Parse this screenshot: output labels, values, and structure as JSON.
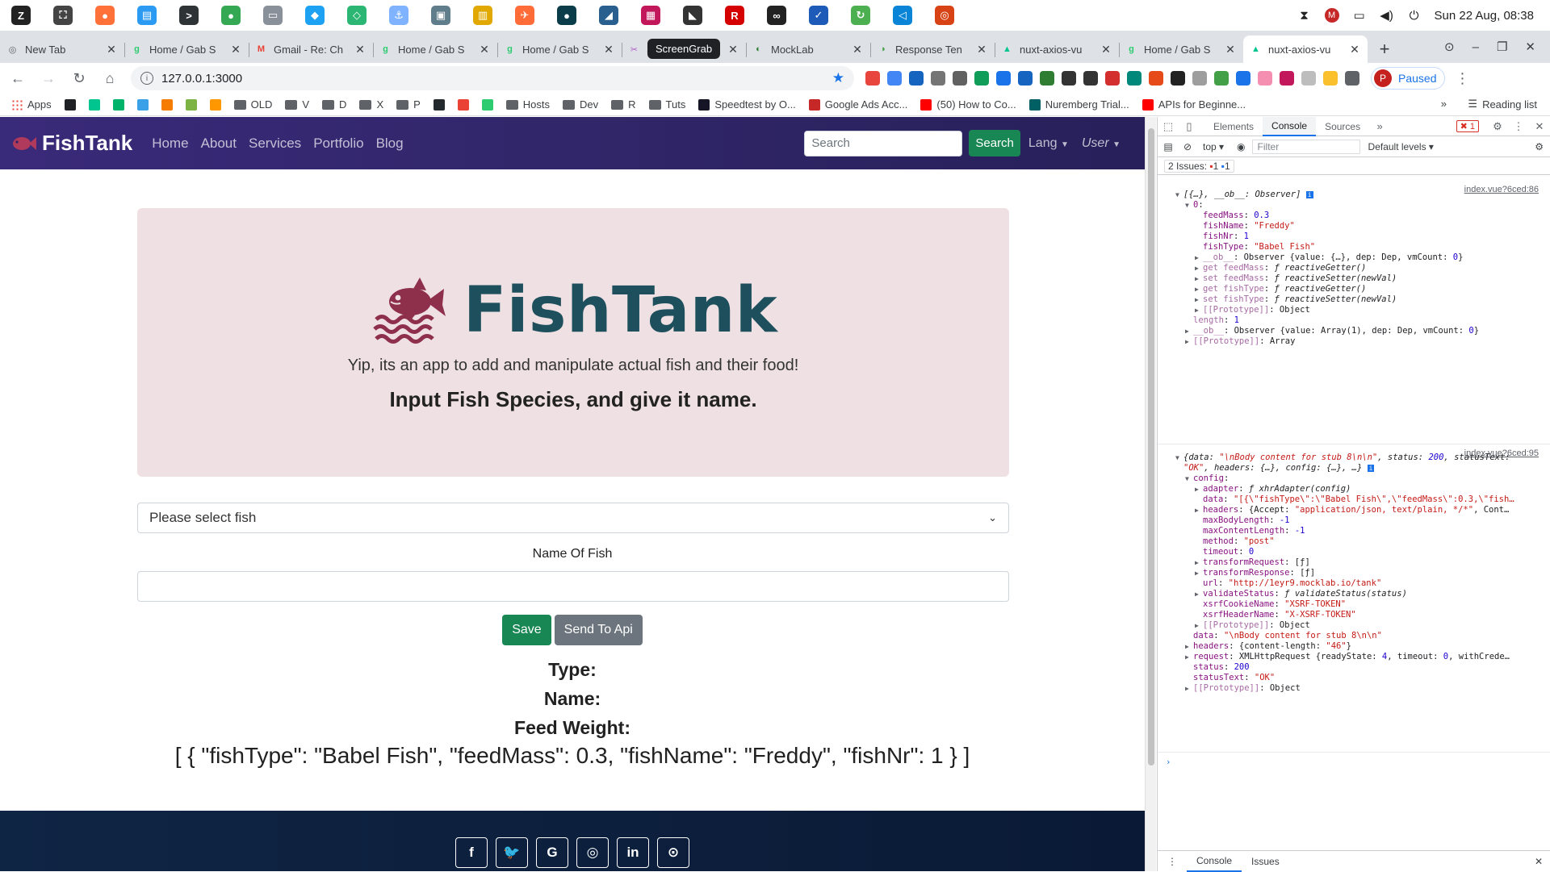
{
  "os": {
    "clock": "Sun 22 Aug, 08:38",
    "apps": [
      {
        "name": "zorin-menu-icon",
        "color": "#222222",
        "glyph": "Z"
      },
      {
        "name": "screenshot-icon",
        "color": "#444444",
        "glyph": "⛶"
      },
      {
        "name": "firefox-icon",
        "color": "#ff7139",
        "glyph": "●"
      },
      {
        "name": "store-icon",
        "color": "#2b9af3",
        "glyph": "▤"
      },
      {
        "name": "terminal-icon",
        "color": "#2e3436",
        "glyph": ">"
      },
      {
        "name": "chrome-icon",
        "color": "#34a853",
        "glyph": "●"
      },
      {
        "name": "files-icon",
        "color": "#8a9099",
        "glyph": "▭"
      },
      {
        "name": "bird-icon",
        "color": "#1da1f2",
        "glyph": "◆"
      },
      {
        "name": "vpn-icon",
        "color": "#2bb673",
        "glyph": "◇"
      },
      {
        "name": "docker-icon",
        "color": "#7fb3ff",
        "glyph": "⚓"
      },
      {
        "name": "app-icon",
        "color": "#607d8b",
        "glyph": "▣"
      },
      {
        "name": "database-icon",
        "color": "#e0a800",
        "glyph": "▥"
      },
      {
        "name": "postman-icon",
        "color": "#ff6c37",
        "glyph": "✈"
      },
      {
        "name": "gitkraken-icon",
        "color": "#0b3c49",
        "glyph": "●"
      },
      {
        "name": "mysql-icon",
        "color": "#285f8f",
        "glyph": "◢"
      },
      {
        "name": "db-tool-icon",
        "color": "#c2185b",
        "glyph": "▦"
      },
      {
        "name": "cat-icon",
        "color": "#333333",
        "glyph": "◣"
      },
      {
        "name": "rubymine-icon",
        "color": "#d50000",
        "glyph": "R"
      },
      {
        "name": "glasses-icon",
        "color": "#222222",
        "glyph": "∞"
      },
      {
        "name": "tasks-icon",
        "color": "#1e5bb8",
        "glyph": "✓"
      },
      {
        "name": "refresh-app-icon",
        "color": "#4caf50",
        "glyph": "↻"
      },
      {
        "name": "vscode-icon",
        "color": "#0a84d6",
        "glyph": "◁"
      },
      {
        "name": "ring-icon",
        "color": "#d84315",
        "glyph": "◎"
      }
    ]
  },
  "browser": {
    "tabs": [
      {
        "label": "New Tab",
        "fav": "#5f6368",
        "glyph": "◎"
      },
      {
        "label": "Home / Gab S",
        "fav": "#2ecc71",
        "glyph": "g"
      },
      {
        "label": "Gmail - Re: Ch",
        "fav": "#ea4335",
        "glyph": "M"
      },
      {
        "label": "Home / Gab S",
        "fav": "#2ecc71",
        "glyph": "g"
      },
      {
        "label": "Home / Gab S",
        "fav": "#2ecc71",
        "glyph": "g"
      },
      {
        "label": "ScreenGrab",
        "fav": "#b05cc7",
        "glyph": "✂"
      },
      {
        "label": "MockLab",
        "fav": "#2e7d32",
        "glyph": "◐"
      },
      {
        "label": "Response Ten",
        "fav": "#43a047",
        "glyph": "◑"
      },
      {
        "label": "nuxt-axios-vu",
        "fav": "#00c58e",
        "glyph": "▲"
      },
      {
        "label": "Home / Gab S",
        "fav": "#2ecc71",
        "glyph": "g"
      },
      {
        "label": "nuxt-axios-vu",
        "fav": "#00c58e",
        "glyph": "▲"
      }
    ],
    "tooltip": "ScreenGrab",
    "url": "127.0.0.1:3000",
    "paused_label": "Paused",
    "profile_initial": "P",
    "bookmarks": [
      {
        "label": "Apps",
        "kind": "apps",
        "color": "#e8453c"
      },
      {
        "label": "",
        "kind": "icon",
        "color": "#202124"
      },
      {
        "label": "",
        "kind": "icon",
        "color": "#00c58e"
      },
      {
        "label": "",
        "kind": "icon",
        "color": "#00b36b"
      },
      {
        "label": "",
        "kind": "icon",
        "color": "#3aa0e8"
      },
      {
        "label": "",
        "kind": "icon",
        "color": "#f57c00"
      },
      {
        "label": "",
        "kind": "icon",
        "color": "#7cb342"
      },
      {
        "label": "",
        "kind": "icon",
        "color": "#ff9800"
      },
      {
        "label": "OLD",
        "kind": "folder",
        "color": "#5f6368"
      },
      {
        "label": "V",
        "kind": "folder",
        "color": "#5f6368"
      },
      {
        "label": "D",
        "kind": "folder",
        "color": "#5f6368"
      },
      {
        "label": "X",
        "kind": "folder",
        "color": "#5f6368"
      },
      {
        "label": "P",
        "kind": "folder",
        "color": "#5f6368"
      },
      {
        "label": "",
        "kind": "icon",
        "color": "#24292e"
      },
      {
        "label": "",
        "kind": "icon",
        "color": "#ea4335"
      },
      {
        "label": "",
        "kind": "icon",
        "color": "#2ecc71"
      },
      {
        "label": "Hosts",
        "kind": "folder",
        "color": "#5f6368"
      },
      {
        "label": "Dev",
        "kind": "folder",
        "color": "#5f6368"
      },
      {
        "label": "R",
        "kind": "folder",
        "color": "#5f6368"
      },
      {
        "label": "Tuts",
        "kind": "folder",
        "color": "#5f6368"
      },
      {
        "label": "Speedtest by O...",
        "kind": "icon",
        "color": "#141526"
      },
      {
        "label": "Google Ads Acc...",
        "kind": "icon",
        "color": "#c62828"
      },
      {
        "label": "(50) How to Co...",
        "kind": "icon",
        "color": "#ff0000"
      },
      {
        "label": "Nuremberg Trial...",
        "kind": "icon",
        "color": "#006064"
      },
      {
        "label": "APIs for Beginne...",
        "kind": "icon",
        "color": "#ff0000"
      }
    ],
    "more_bookmarks": "»",
    "reading_list": "Reading list"
  },
  "site": {
    "brand": "FishTank",
    "nav": [
      "Home",
      "About",
      "Services",
      "Portfolio",
      "Blog"
    ],
    "search_placeholder": "Search",
    "search_button": "Search",
    "lang": "Lang",
    "user": "User",
    "hero_title": "FishTank",
    "hero_tagline": "Yip, its an app to add and manipulate actual fish and their food!",
    "hero_subtitle": "Input Fish Species, and give it name.",
    "select_value": "Please select fish",
    "name_label": "Name Of Fish",
    "name_value": "",
    "save_button": "Save",
    "api_button": "Send To Api",
    "type_label": "Type:",
    "name_out_label": "Name:",
    "feed_label": "Feed Weight:",
    "json_output": "[ { \"fishType\": \"Babel Fish\", \"feedMass\": 0.3, \"fishName\": \"Freddy\", \"fishNr\": 1 } ]",
    "social": [
      {
        "name": "facebook-icon",
        "glyph": "f"
      },
      {
        "name": "twitter-icon",
        "glyph": "🐦"
      },
      {
        "name": "google-icon",
        "glyph": "G"
      },
      {
        "name": "instagram-icon",
        "glyph": "◎"
      },
      {
        "name": "linkedin-icon",
        "glyph": "in"
      },
      {
        "name": "github-icon",
        "glyph": "⊙"
      }
    ],
    "colors": {
      "navbar": "#2f2566",
      "hero_bg": "#efe1e3",
      "logo_fish": "#8e2f4b",
      "logo_text": "#1d4f5c",
      "success": "#198754",
      "secondary": "#6c757d",
      "footer": "#0f2544"
    }
  },
  "devtools": {
    "tabs": [
      "Elements",
      "Console",
      "Sources"
    ],
    "active_tab": "Console",
    "error_badge": "1",
    "context": "top",
    "filter_placeholder": "Filter",
    "levels": "Default levels",
    "issues_label": "2 Issues:",
    "issues_errors": "1",
    "issues_info": "1",
    "bottom_tabs": [
      "Console",
      "Issues"
    ],
    "log1_src": "index.vue?6ced:86",
    "log2_src": "index.vue?6ced:95",
    "lines": [
      {
        "t": "▼",
        "html": "<span class='f'>[{…}, __ob__: Observer]</span> <span style='background:#1a73e8;color:#fff;font-size:8px;padding:0 2px'>i</span>"
      },
      {
        "t": "▼",
        "html": "<span class='k'>0</span>:"
      },
      {
        "t": "",
        "html": "<span class='k'>feedMass</span>: <span class='n'>0.3</span>"
      },
      {
        "t": "",
        "html": "<span class='k'>fishName</span>: <span class='s'>\"Freddy\"</span>"
      },
      {
        "t": "",
        "html": "<span class='k'>fishNr</span>: <span class='n'>1</span>"
      },
      {
        "t": "",
        "html": "<span class='k'>fishType</span>: <span class='s'>\"Babel Fish\"</span>"
      },
      {
        "t": "▶",
        "html": "<span class='kd'>__ob__</span>: Observer {value: {…}, dep: Dep, vmCount: <span class='n'>0</span>}"
      },
      {
        "t": "▶",
        "html": "<span class='kd'>get feedMass</span>: <span class='f'>ƒ reactiveGetter()</span>"
      },
      {
        "t": "▶",
        "html": "<span class='kd'>set feedMass</span>: <span class='f'>ƒ reactiveSetter(newVal)</span>"
      },
      {
        "t": "▶",
        "html": "<span class='kd'>get fishType</span>: <span class='f'>ƒ reactiveGetter()</span>"
      },
      {
        "t": "▶",
        "html": "<span class='kd'>set fishType</span>: <span class='f'>ƒ reactiveSetter(newVal)</span>"
      },
      {
        "t": "▶",
        "html": "<span class='kd'>[[Prototype]]</span>: Object"
      },
      {
        "t": "",
        "html": "<span class='kd'>length</span>: <span class='n'>1</span>"
      },
      {
        "t": "▶",
        "html": "<span class='kd'>__ob__</span>: Observer {value: Array(1), dep: Dep, vmCount: <span class='n'>0</span>}"
      },
      {
        "t": "▶",
        "html": "<span class='kd'>[[Prototype]]</span>: Array"
      },
      {
        "t": "▼",
        "html": "<span class='f'>{data: <span class='s'>\"\\nBody content for stub 8\\n\\n\"</span>, status: <span class='n'>200</span>, statusText:</span>"
      },
      {
        "t": "",
        "html": "<span class='f'><span class='s'>\"OK\"</span>, headers: {…}, config: {…}, …}</span> <span style='background:#1a73e8;color:#fff;font-size:8px;padding:0 2px'>i</span>"
      },
      {
        "t": "▼",
        "html": "<span class='k'>config</span>:"
      },
      {
        "t": "▶",
        "html": "<span class='k'>adapter</span>: <span class='f'>ƒ xhrAdapter(config)</span>"
      },
      {
        "t": "",
        "html": "<span class='k'>data</span>: <span class='s'>\"[{\\\"fishType\\\":\\\"Babel Fish\\\",\\\"feedMass\\\":0.3,\\\"fish…</span>"
      },
      {
        "t": "▶",
        "html": "<span class='k'>headers</span>: {Accept: <span class='s'>\"application/json, text/plain, */*\"</span>, Cont…"
      },
      {
        "t": "",
        "html": "<span class='k'>maxBodyLength</span>: <span class='n'>-1</span>"
      },
      {
        "t": "",
        "html": "<span class='k'>maxContentLength</span>: <span class='n'>-1</span>"
      },
      {
        "t": "",
        "html": "<span class='k'>method</span>: <span class='s'>\"post\"</span>"
      },
      {
        "t": "",
        "html": "<span class='k'>timeout</span>: <span class='n'>0</span>"
      },
      {
        "t": "▶",
        "html": "<span class='k'>transformRequest</span>: [ƒ]"
      },
      {
        "t": "▶",
        "html": "<span class='k'>transformResponse</span>: [ƒ]"
      },
      {
        "t": "",
        "html": "<span class='k'>url</span>: <span class='s'>\"http://1eyr9.mocklab.io/tank\"</span>"
      },
      {
        "t": "▶",
        "html": "<span class='k'>validateStatus</span>: <span class='f'>ƒ validateStatus(status)</span>"
      },
      {
        "t": "",
        "html": "<span class='k'>xsrfCookieName</span>: <span class='s'>\"XSRF-TOKEN\"</span>"
      },
      {
        "t": "",
        "html": "<span class='k'>xsrfHeaderName</span>: <span class='s'>\"X-XSRF-TOKEN\"</span>"
      },
      {
        "t": "▶",
        "html": "<span class='kd'>[[Prototype]]</span>: Object"
      },
      {
        "t": "",
        "html": "<span class='k'>data</span>: <span class='s'>\"\\nBody content for stub 8\\n\\n\"</span>"
      },
      {
        "t": "▶",
        "html": "<span class='k'>headers</span>: {content-length: <span class='s'>\"46\"</span>}"
      },
      {
        "t": "▶",
        "html": "<span class='k'>request</span>: XMLHttpRequest {readyState: <span class='n'>4</span>, timeout: <span class='n'>0</span>, withCrede…"
      },
      {
        "t": "",
        "html": "<span class='k'>status</span>: <span class='n'>200</span>"
      },
      {
        "t": "",
        "html": "<span class='k'>statusText</span>: <span class='s'>\"OK\"</span>"
      },
      {
        "t": "▶",
        "html": "<span class='kd'>[[Prototype]]</span>: Object"
      }
    ]
  }
}
